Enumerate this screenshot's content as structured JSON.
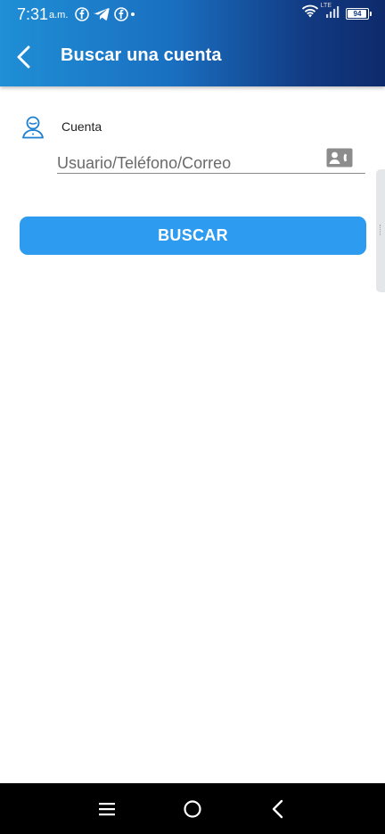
{
  "status_bar": {
    "time": "7:31",
    "ampm": "a.m.",
    "network_label": "LTE",
    "battery_level": "94",
    "notification_icons": [
      "facebook-icon",
      "telegram-icon",
      "facebook-icon"
    ]
  },
  "app_bar": {
    "title": "Buscar una cuenta",
    "back_icon": "back-arrow-icon"
  },
  "form": {
    "account_label": "Cuenta",
    "search_placeholder": "Usuario/Teléfono/Correo",
    "search_value": "",
    "contact_icon": "contact-card-icon",
    "submit_label": "BUSCAR"
  },
  "colors": {
    "header_start": "#1f8fd6",
    "header_end": "#0e2a6b",
    "button": "#2d9cf0",
    "icon_blue": "#1d7fd0"
  },
  "nav_bar": {
    "icons": [
      "menu-icon",
      "home-icon",
      "back-icon"
    ]
  }
}
